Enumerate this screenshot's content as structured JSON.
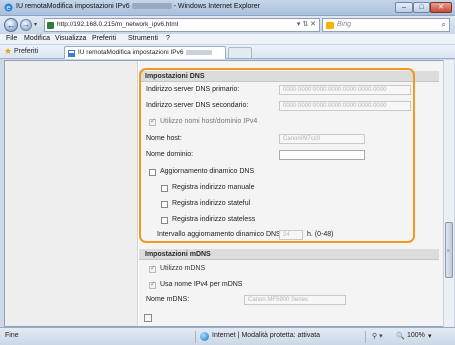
{
  "window": {
    "title": "IU remotaModifica impostazioni IPv6",
    "browser_suffix": "- Windows Internet Explorer",
    "minimize": "–",
    "maximize": "□",
    "close": "✕"
  },
  "nav": {
    "back": "←",
    "forward": "→",
    "url": "http://192.168.0.215/m_network_ipv6.html",
    "tools": "▾ ⇅ ✕",
    "search_placeholder": "Bing",
    "search_icon": "search-icon"
  },
  "menu": [
    "File",
    "Modifica",
    "Visualizza",
    "Preferiti",
    "Strumenti",
    "?"
  ],
  "favorites": {
    "label": "Preferiti",
    "tab_label": "IU remotaModifica impostazioni IPv6"
  },
  "dns": {
    "header": "Impostazioni DNS",
    "primary_label": "Indirizzo server DNS primario:",
    "primary_value": "0000:0000:0000:0000:0000:0000:0000",
    "secondary_label": "Indirizzo server DNS secondario:",
    "secondary_value": "0000:0000:0000:0000:0000:0000:0000",
    "use_ipv4_label": "Utilizzo nomi host/dominio IPv4",
    "host_label": "Nome host:",
    "host_value": "Canon097cc0",
    "domain_label": "Nome dominio:",
    "domain_value": "",
    "dynamic_label": "Aggiornamento dinamico DNS",
    "manual_label": "Registra indirizzo manuale",
    "stateful_label": "Registra indirizzo stateful",
    "stateless_label": "Registra indirizzo stateless",
    "interval_label": "Intervallo aggiornamento dinamico DNS:",
    "interval_value": "24",
    "interval_unit": "h. (0-48)"
  },
  "mdns": {
    "header": "Impostazioni mDNS",
    "use_label": "Utilizzo mDNS",
    "use_ipv4_label": "Usa nome IPv4 per mDNS",
    "name_label": "Nome mDNS:",
    "name_value": "Canon MF5900 Series"
  },
  "status": {
    "left": "Fine",
    "zone": "Internet | Modalità protetta: attivata",
    "zoom": "100%",
    "zoom_arrow": "▾"
  },
  "colors": {
    "highlight": "#f09a22",
    "section_header": "#dcdcdc"
  }
}
